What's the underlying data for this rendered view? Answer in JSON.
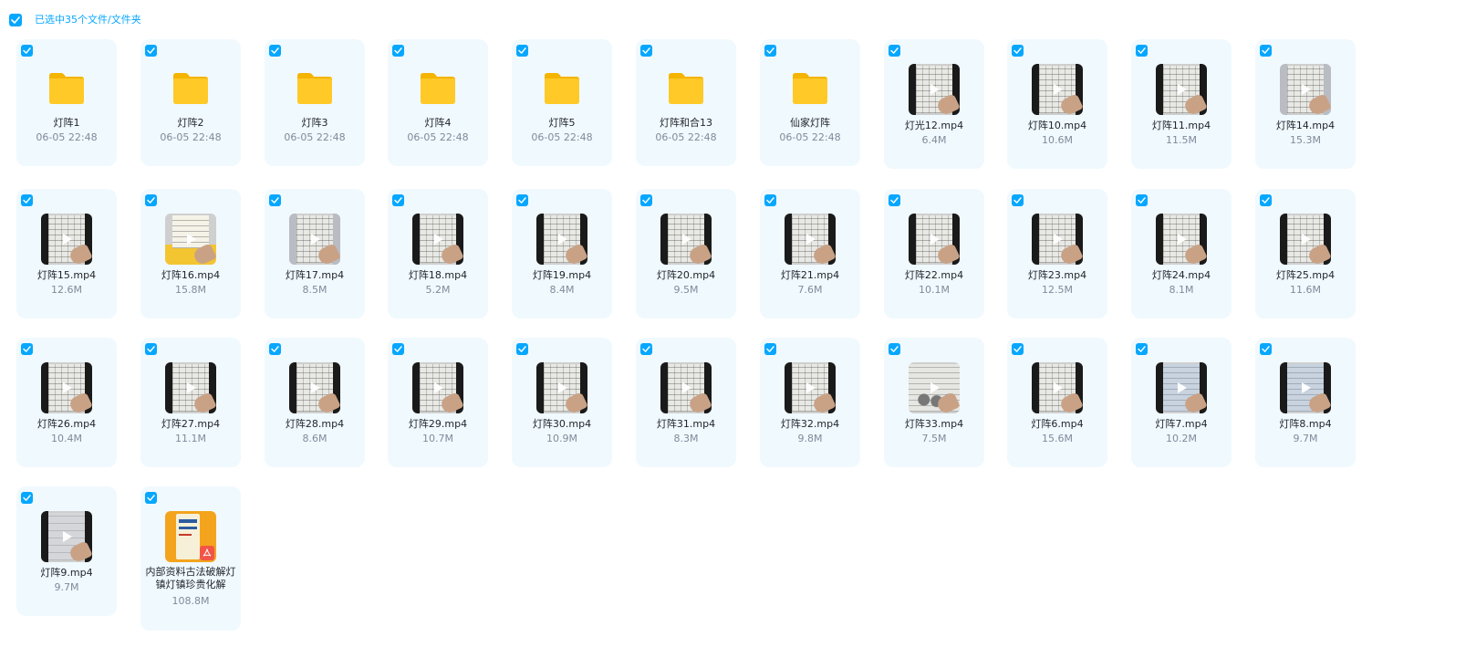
{
  "selection": {
    "label": "已选中35个文件/文件夹"
  },
  "items": [
    {
      "type": "folder",
      "name": "灯阵1",
      "meta": "06-05 22:48"
    },
    {
      "type": "folder",
      "name": "灯阵2",
      "meta": "06-05 22:48"
    },
    {
      "type": "folder",
      "name": "灯阵3",
      "meta": "06-05 22:48"
    },
    {
      "type": "folder",
      "name": "灯阵4",
      "meta": "06-05 22:48"
    },
    {
      "type": "folder",
      "name": "灯阵5",
      "meta": "06-05 22:48"
    },
    {
      "type": "folder",
      "name": "灯阵和合13",
      "meta": "06-05 22:48"
    },
    {
      "type": "folder",
      "name": "仙家灯阵",
      "meta": "06-05 22:48"
    },
    {
      "type": "video",
      "name": "灯光12.mp4",
      "meta": "6.4M"
    },
    {
      "type": "video",
      "name": "灯阵10.mp4",
      "meta": "10.6M"
    },
    {
      "type": "video",
      "name": "灯阵11.mp4",
      "meta": "11.5M"
    },
    {
      "type": "video",
      "name": "灯阵14.mp4",
      "meta": "15.3M"
    },
    {
      "type": "video",
      "name": "灯阵15.mp4",
      "meta": "12.6M"
    },
    {
      "type": "video",
      "name": "灯阵16.mp4",
      "meta": "15.8M"
    },
    {
      "type": "video",
      "name": "灯阵17.mp4",
      "meta": "8.5M"
    },
    {
      "type": "video",
      "name": "灯阵18.mp4",
      "meta": "5.2M"
    },
    {
      "type": "video",
      "name": "灯阵19.mp4",
      "meta": "8.4M"
    },
    {
      "type": "video",
      "name": "灯阵20.mp4",
      "meta": "9.5M"
    },
    {
      "type": "video",
      "name": "灯阵21.mp4",
      "meta": "7.6M"
    },
    {
      "type": "video",
      "name": "灯阵22.mp4",
      "meta": "10.1M"
    },
    {
      "type": "video",
      "name": "灯阵23.mp4",
      "meta": "12.5M"
    },
    {
      "type": "video",
      "name": "灯阵24.mp4",
      "meta": "8.1M"
    },
    {
      "type": "video",
      "name": "灯阵25.mp4",
      "meta": "11.6M"
    },
    {
      "type": "video",
      "name": "灯阵26.mp4",
      "meta": "10.4M"
    },
    {
      "type": "video",
      "name": "灯阵27.mp4",
      "meta": "11.1M"
    },
    {
      "type": "video",
      "name": "灯阵28.mp4",
      "meta": "8.6M"
    },
    {
      "type": "video",
      "name": "灯阵29.mp4",
      "meta": "10.7M"
    },
    {
      "type": "video",
      "name": "灯阵30.mp4",
      "meta": "10.9M"
    },
    {
      "type": "video",
      "name": "灯阵31.mp4",
      "meta": "8.3M"
    },
    {
      "type": "video",
      "name": "灯阵32.mp4",
      "meta": "9.8M"
    },
    {
      "type": "video",
      "name": "灯阵33.mp4",
      "meta": "7.5M"
    },
    {
      "type": "video",
      "name": "灯阵6.mp4",
      "meta": "15.6M"
    },
    {
      "type": "video",
      "name": "灯阵7.mp4",
      "meta": "10.2M"
    },
    {
      "type": "video",
      "name": "灯阵8.mp4",
      "meta": "9.7M"
    },
    {
      "type": "video",
      "name": "灯阵9.mp4",
      "meta": "9.7M"
    },
    {
      "type": "pdf",
      "name": "内部资料古法破解灯镇灯镇珍贵化解",
      "meta": "108.8M"
    }
  ],
  "colors": {
    "accent": "#06a7ff",
    "card": "#f0f9fe",
    "meta_text": "#818999"
  },
  "icons": {
    "checkbox": "checkbox-checked-icon",
    "folder": "folder-icon",
    "video": "play-icon",
    "pdf": "pdf-icon"
  }
}
